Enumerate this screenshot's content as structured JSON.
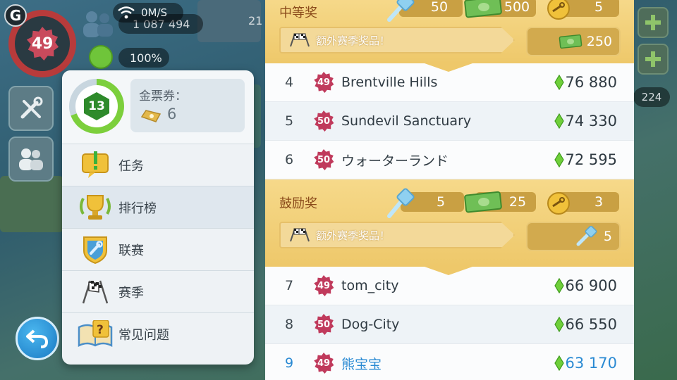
{
  "hud": {
    "network_speed": "0M/S",
    "population": "1 087 494",
    "happiness": "100%",
    "player_level": "49",
    "side_value": "224",
    "partial_value": "21"
  },
  "profile": {
    "level": "13",
    "golden_ticket_label": "金票券：",
    "golden_ticket_count": "6"
  },
  "menu": {
    "items": [
      {
        "label": "任务",
        "icon": "quest-icon"
      },
      {
        "label": "排行榜",
        "icon": "trophy-icon"
      },
      {
        "label": "联赛",
        "icon": "league-shield-icon"
      },
      {
        "label": "赛季",
        "icon": "checkered-flags-icon"
      },
      {
        "label": "常见问题",
        "icon": "faq-book-icon"
      }
    ],
    "active_index": 1
  },
  "leaderboard": {
    "tiers": [
      {
        "title": "中等奖",
        "rewards": {
          "keys": "50",
          "simoleons": "500",
          "golden_keys": "5"
        },
        "bonus_label": "额外赛季奖品！",
        "bonus_reward": "250",
        "bonus_reward_icon": "cash-icon"
      },
      {
        "title": "鼓励奖",
        "rewards": {
          "keys": "5",
          "simoleons": "25",
          "golden_keys": "3"
        },
        "bonus_label": "额外赛季奖品！",
        "bonus_reward": "5",
        "bonus_reward_icon": "key-icon"
      }
    ],
    "rows_tier1": [
      {
        "rank": "4",
        "level": "49",
        "name": "Brentville Hills",
        "score": "76 880"
      },
      {
        "rank": "5",
        "level": "50",
        "name": "Sundevil Sanctuary",
        "score": "74 330"
      },
      {
        "rank": "6",
        "level": "50",
        "name": "ウォーターランド",
        "score": "72 595"
      }
    ],
    "rows_tier2": [
      {
        "rank": "7",
        "level": "49",
        "name": "tom_city",
        "score": "66 900"
      },
      {
        "rank": "8",
        "level": "50",
        "name": "Dog-City",
        "score": "66 550"
      },
      {
        "rank": "9",
        "level": "49",
        "name": "熊宝宝",
        "score": "63 170"
      }
    ]
  },
  "colors": {
    "tier_gold": "#eec86a",
    "highlight_blue": "#2a8ad3",
    "level_ring_red": "#b83b3b",
    "level_ring_green": "#7ccf3c"
  }
}
